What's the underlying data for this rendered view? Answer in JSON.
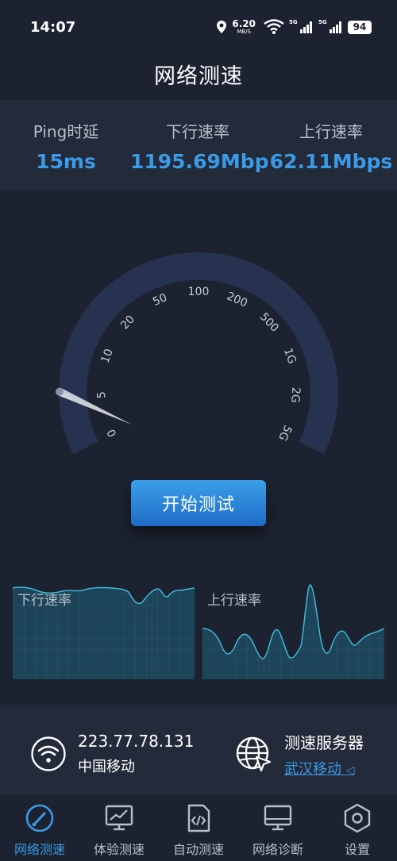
{
  "status_bar": {
    "time": "14:07",
    "net_speed_value": "6.20",
    "net_speed_unit": "MB/S",
    "signal_tag_1": "5G",
    "signal_tag_2": "5G",
    "battery": "94"
  },
  "header": {
    "title": "网络测速"
  },
  "stats": {
    "ping_label": "Ping时延",
    "ping_value": "15ms",
    "download_label": "下行速率",
    "download_value": "1195.69Mbp",
    "upload_label": "上行速率",
    "upload_value": "62.11Mbps"
  },
  "gauge": {
    "ticks": [
      "0",
      "5",
      "10",
      "20",
      "50",
      "100",
      "200",
      "500",
      "1G",
      "2G",
      "5G"
    ],
    "needle_value_fraction": 0.22
  },
  "start_button": {
    "label": "开始测试"
  },
  "charts": {
    "download_label": "下行速率",
    "upload_label": "上行速率"
  },
  "info": {
    "ip_address": "223.77.78.131",
    "isp": "中国移动",
    "server_title": "测速服务器",
    "server_name": "武汉移动"
  },
  "nav": {
    "items": [
      {
        "label": "网络测速",
        "icon": "speedometer-icon",
        "active": true
      },
      {
        "label": "体验测速",
        "icon": "monitor-chart-icon",
        "active": false
      },
      {
        "label": "自动测速",
        "icon": "code-document-icon",
        "active": false
      },
      {
        "label": "网络诊断",
        "icon": "monitor-icon",
        "active": false
      },
      {
        "label": "设置",
        "icon": "hexagon-settings-icon",
        "active": false
      }
    ]
  },
  "colors": {
    "background": "#1c2230",
    "panel": "#232a3a",
    "accent": "#3b9ae8",
    "gauge_arc": "#26324f",
    "chart_fill": "#1d4458",
    "chart_line": "#3eb8d8"
  }
}
